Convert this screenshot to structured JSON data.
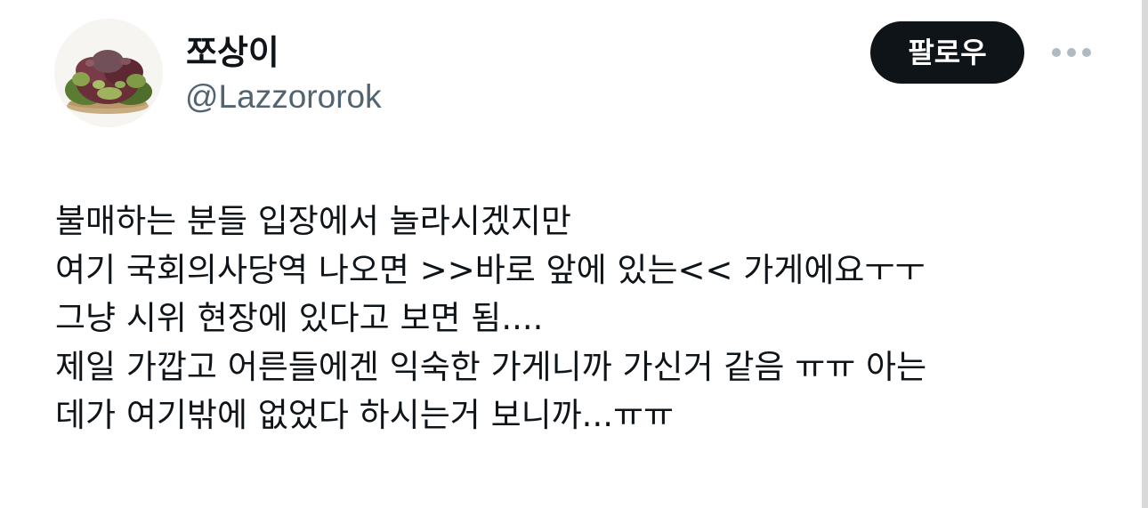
{
  "user": {
    "display_name": "쪼상이",
    "handle": "@Lazzororok",
    "avatar_icon": "lettuce-avatar-icon"
  },
  "actions": {
    "follow_label": "팔로우",
    "more_icon": "more-options-icon"
  },
  "tweet": {
    "lines": [
      "불매하는 분들 입장에서 놀라시겠지만",
      "여기 국회의사당역 나오면 >>바로 앞에 있는<< 가게에요ㅜㅜ",
      "그냥 시위 현장에 있다고 보면 됨....",
      "제일 가깝고 어른들에겐 익숙한 가게니까 가신거 같음 ㅠㅠ 아는",
      "데가 여기밖에 없었다 하시는거 보니까...ㅠㅠ"
    ]
  },
  "colors": {
    "text_primary": "#0f1419",
    "text_secondary": "#536471",
    "button_bg": "#0f1419",
    "button_text": "#ffffff",
    "more_dots": "#afbac2"
  }
}
